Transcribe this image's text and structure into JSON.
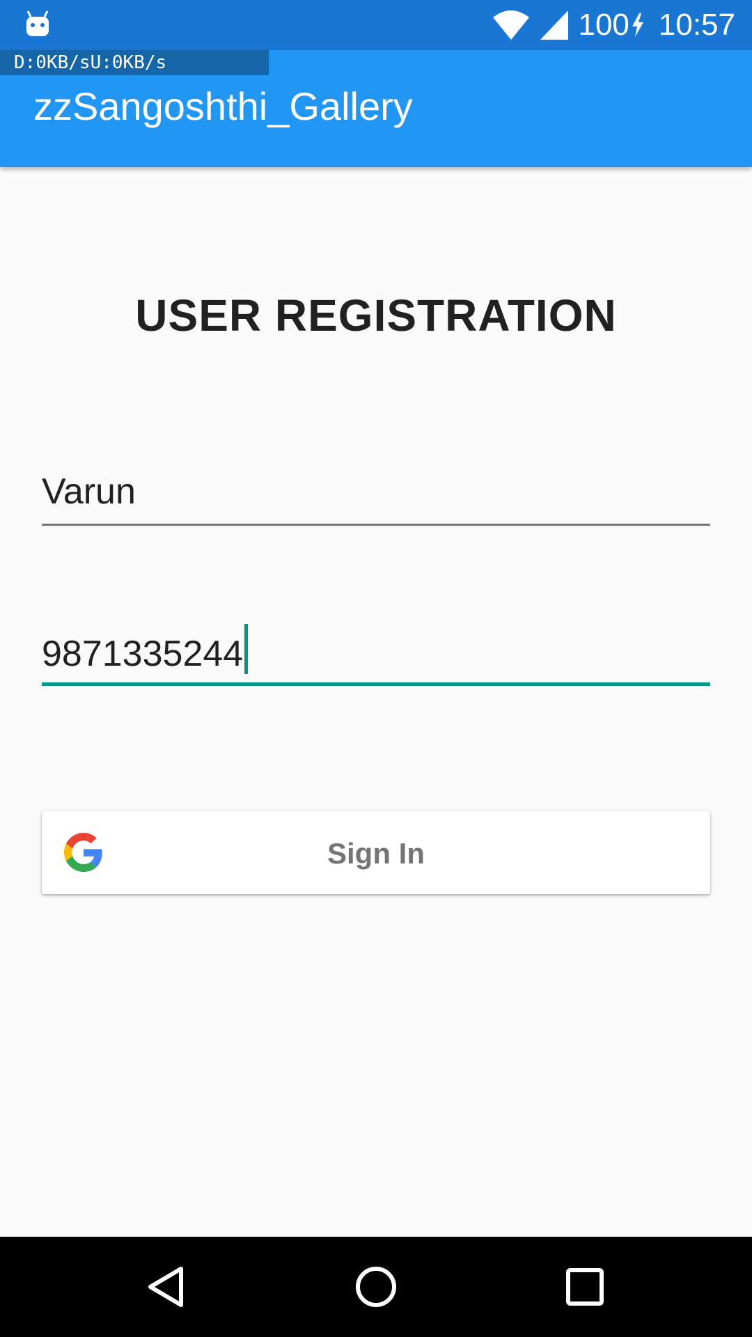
{
  "status_bar": {
    "battery": "100",
    "time": "10:57",
    "icons": [
      "android-debug-icon",
      "wifi-icon",
      "cell-signal-icon",
      "charging-icon"
    ]
  },
  "net_speed": {
    "down": "D:0KB/s",
    "up": "U:0KB/s"
  },
  "app_bar": {
    "title": "zzSangoshthi_Gallery"
  },
  "form": {
    "heading": "USER REGISTRATION",
    "name_value": "Varun",
    "phone_value": "9871335244"
  },
  "signin_button": {
    "label": "Sign In",
    "icon": "google-icon"
  },
  "nav_bar": {
    "icons": [
      "back-icon",
      "home-icon",
      "recents-icon"
    ]
  },
  "colors": {
    "status_bar": "#1976d2",
    "app_bar": "#2196f3",
    "accent": "#009688",
    "background": "#fafafa"
  }
}
